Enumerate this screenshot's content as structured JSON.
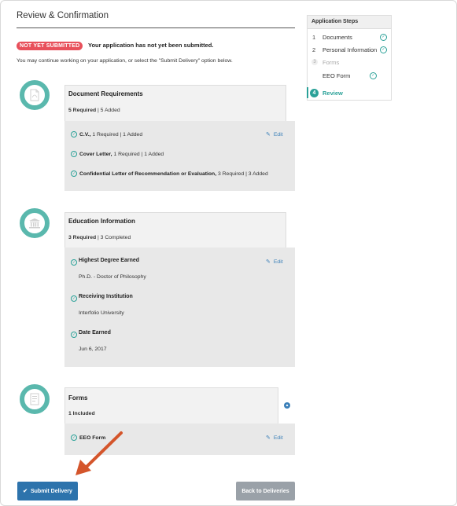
{
  "page": {
    "title": "Review & Confirmation",
    "status_badge": "NOT YET SUBMITTED",
    "status_message": "Your application has not yet been submitted.",
    "instructions": "You may continue working on your application, or select the \"Submit Delivery\" option below."
  },
  "steps": {
    "title": "Application Steps",
    "items": [
      {
        "num": "1",
        "label": "Documents",
        "state": "complete"
      },
      {
        "num": "2",
        "label": "Personal Information",
        "state": "complete"
      },
      {
        "num": "3",
        "label": "Forms",
        "state": "group"
      },
      {
        "num": "",
        "label": "EEO Form",
        "state": "complete"
      },
      {
        "num": "4",
        "label": "Review",
        "state": "current"
      }
    ]
  },
  "documents": {
    "title": "Document Requirements",
    "summary_bold": "5 Required",
    "summary_rest": " | 5 Added",
    "edit_label": "Edit",
    "items": [
      {
        "name": "C.V.,",
        "detail": " 1 Required | 1 Added"
      },
      {
        "name": "Cover Letter,",
        "detail": " 1 Required | 1 Added"
      },
      {
        "name": "Confidential Letter of Recommendation or Evaluation,",
        "detail": " 3 Required | 3 Added"
      }
    ]
  },
  "education": {
    "title": "Education Information",
    "summary_bold": "3 Required",
    "summary_rest": " | 3 Completed",
    "edit_label": "Edit",
    "fields": [
      {
        "label": "Highest Degree Earned",
        "value": "Ph.D. - Doctor of Philosophy"
      },
      {
        "label": "Receiving Institution",
        "value": "Interfolio University"
      },
      {
        "label": "Date Earned",
        "value": "Jun 6, 2017"
      }
    ]
  },
  "forms": {
    "title": "Forms",
    "summary": "1 Included",
    "edit_label": "Edit",
    "items": [
      {
        "name": "EEO Form"
      }
    ]
  },
  "actions": {
    "submit_label": "Submit Delivery",
    "back_label": "Back to Deliveries"
  },
  "colors": {
    "accent_teal": "#2aa198",
    "badge_red": "#e8505b",
    "primary_blue": "#2d73ac",
    "annotation_arrow": "#d4552b"
  },
  "icons": {
    "documents_section": "pdf-document-icon",
    "education_section": "institution-icon",
    "forms_section": "form-icon",
    "check": "check-circle-icon",
    "edit": "pencil-icon",
    "collapse": "chevron-up-icon",
    "submit": "checkmark-icon"
  }
}
